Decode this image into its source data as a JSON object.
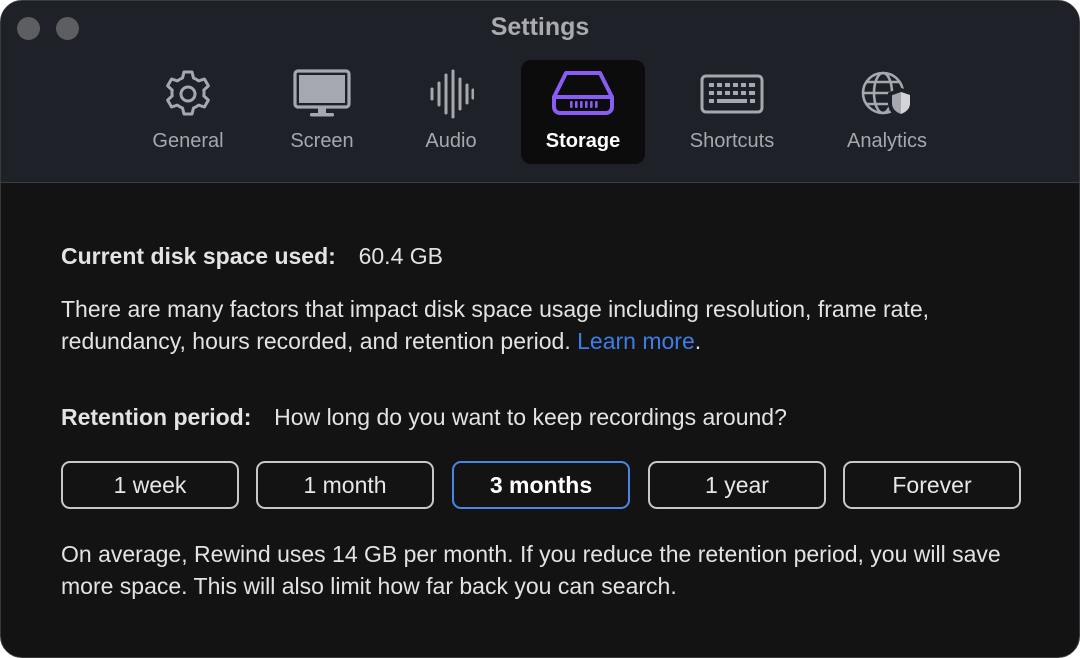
{
  "window": {
    "title": "Settings"
  },
  "tabs": [
    {
      "id": "general",
      "label": "General",
      "icon": "gear-icon"
    },
    {
      "id": "screen",
      "label": "Screen",
      "icon": "monitor-icon"
    },
    {
      "id": "audio",
      "label": "Audio",
      "icon": "waveform-icon"
    },
    {
      "id": "storage",
      "label": "Storage",
      "icon": "drive-icon",
      "active": true
    },
    {
      "id": "shortcuts",
      "label": "Shortcuts",
      "icon": "keyboard-icon"
    },
    {
      "id": "analytics",
      "label": "Analytics",
      "icon": "globe-shield-icon"
    }
  ],
  "storage": {
    "disk_label": "Current disk space used:",
    "disk_value": "60.4 GB",
    "description": "There are many factors that impact disk space usage including resolution, frame rate, redundancy, hours recorded, and retention period.",
    "learn_more": "Learn more",
    "period_end": ".",
    "retention_label": "Retention period:",
    "retention_question": "How long do you want to keep recordings around?",
    "options": [
      "1 week",
      "1 month",
      "3 months",
      "1 year",
      "Forever"
    ],
    "selected_option": "3 months",
    "footer": "On average, Rewind uses 14 GB per month. If you reduce the retention period, you will save more space. This will also limit how far back you can search."
  },
  "colors": {
    "accent_purple": "#8a5cf6",
    "link_blue": "#3d7de8",
    "selected_border": "#4b86e6",
    "window_bg": "#131313",
    "toolbar_bg": "#1e2127"
  }
}
